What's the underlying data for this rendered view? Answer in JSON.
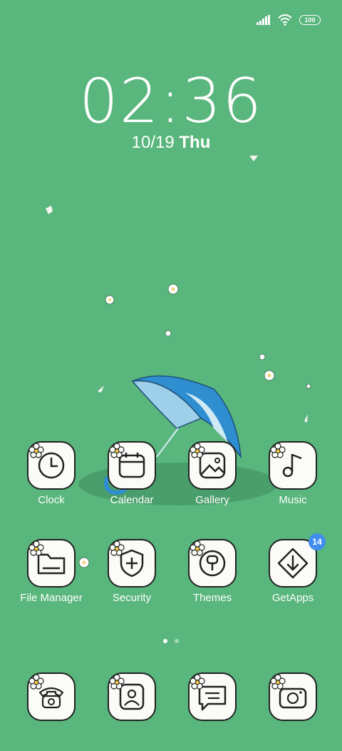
{
  "status_bar": {
    "battery": "100",
    "signal_icon": "signal-bars-icon",
    "wifi_icon": "wifi-icon"
  },
  "lock_clock": {
    "time": "02:36",
    "date": "10/19",
    "day": "Thu"
  },
  "apps_row1": [
    {
      "label": "Clock",
      "icon": "clock-icon"
    },
    {
      "label": "Calendar",
      "icon": "calendar-icon"
    },
    {
      "label": "Gallery",
      "icon": "gallery-icon"
    },
    {
      "label": "Music",
      "icon": "music-note-icon"
    }
  ],
  "apps_row2": [
    {
      "label": "File Manager",
      "icon": "folder-icon"
    },
    {
      "label": "Security",
      "icon": "shield-plus-icon"
    },
    {
      "label": "Themes",
      "icon": "paint-brush-icon"
    },
    {
      "label": "GetApps",
      "icon": "download-icon",
      "badge": "14"
    }
  ],
  "dock": [
    {
      "icon": "phone-icon"
    },
    {
      "icon": "contacts-icon"
    },
    {
      "icon": "messages-icon"
    },
    {
      "icon": "camera-icon"
    }
  ],
  "page_indicator": {
    "pages": 2,
    "active": 1
  },
  "colors": {
    "background": "#59b67c",
    "tile": "#fbfbf7",
    "badge": "#3f8ef0"
  }
}
